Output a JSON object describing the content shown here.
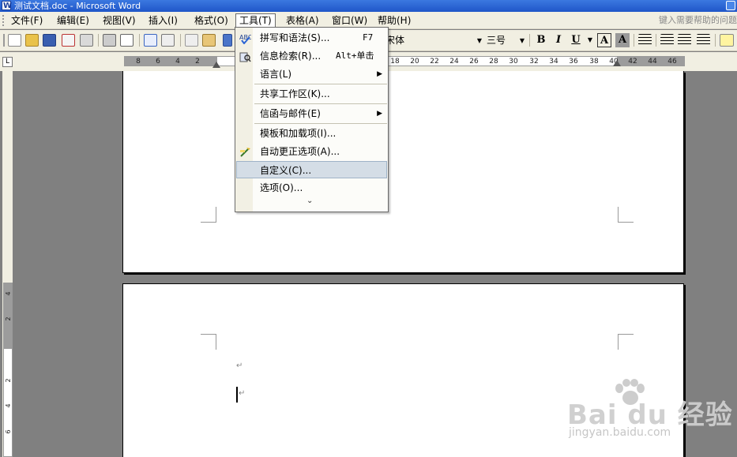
{
  "window": {
    "title": "测试文档.doc - Microsoft Word"
  },
  "menubar": {
    "items": [
      {
        "label": "文件(F)"
      },
      {
        "label": "编辑(E)"
      },
      {
        "label": "视图(V)"
      },
      {
        "label": "插入(I)"
      },
      {
        "label": "格式(O)"
      },
      {
        "label": "工具(T)"
      },
      {
        "label": "表格(A)"
      },
      {
        "label": "窗口(W)"
      },
      {
        "label": "帮助(H)"
      }
    ],
    "help_placeholder": "键入需要帮助的问题"
  },
  "toolbar": {
    "font_name": "宋体",
    "font_size": "三号",
    "bold": "B",
    "italic": "I",
    "underline": "U",
    "char_border": "A",
    "char_shading": "A"
  },
  "ruler": {
    "left_ticks": [
      "8",
      "6",
      "4",
      "2"
    ],
    "right_ticks": [
      "18",
      "20",
      "22",
      "24",
      "26",
      "28",
      "30",
      "32",
      "34",
      "36",
      "38",
      "40",
      "42",
      "44",
      "46"
    ],
    "vertical_ticks": [
      "4",
      "2",
      "2",
      "4",
      "6"
    ]
  },
  "tools_menu": {
    "items": [
      {
        "label": "拼写和语法(S)...",
        "shortcut": "F7"
      },
      {
        "label": "信息检索(R)...",
        "shortcut": "Alt+单击"
      },
      {
        "label": "语言(L)"
      },
      {
        "label": "共享工作区(K)..."
      },
      {
        "label": "信函与邮件(E)"
      },
      {
        "label": "模板和加载项(I)..."
      },
      {
        "label": "自动更正选项(A)..."
      },
      {
        "label": "自定义(C)..."
      },
      {
        "label": "选项(O)..."
      }
    ],
    "expand_glyph": "⌄"
  },
  "document": {
    "paragraph_mark": "↵"
  },
  "watermark": {
    "brand": "Bai du 经验",
    "url": "jingyan.baidu.com"
  },
  "colors": {
    "titlebar": "#2a64d4",
    "menu_hover": "#d4dde6",
    "page_bg": "#808080"
  }
}
